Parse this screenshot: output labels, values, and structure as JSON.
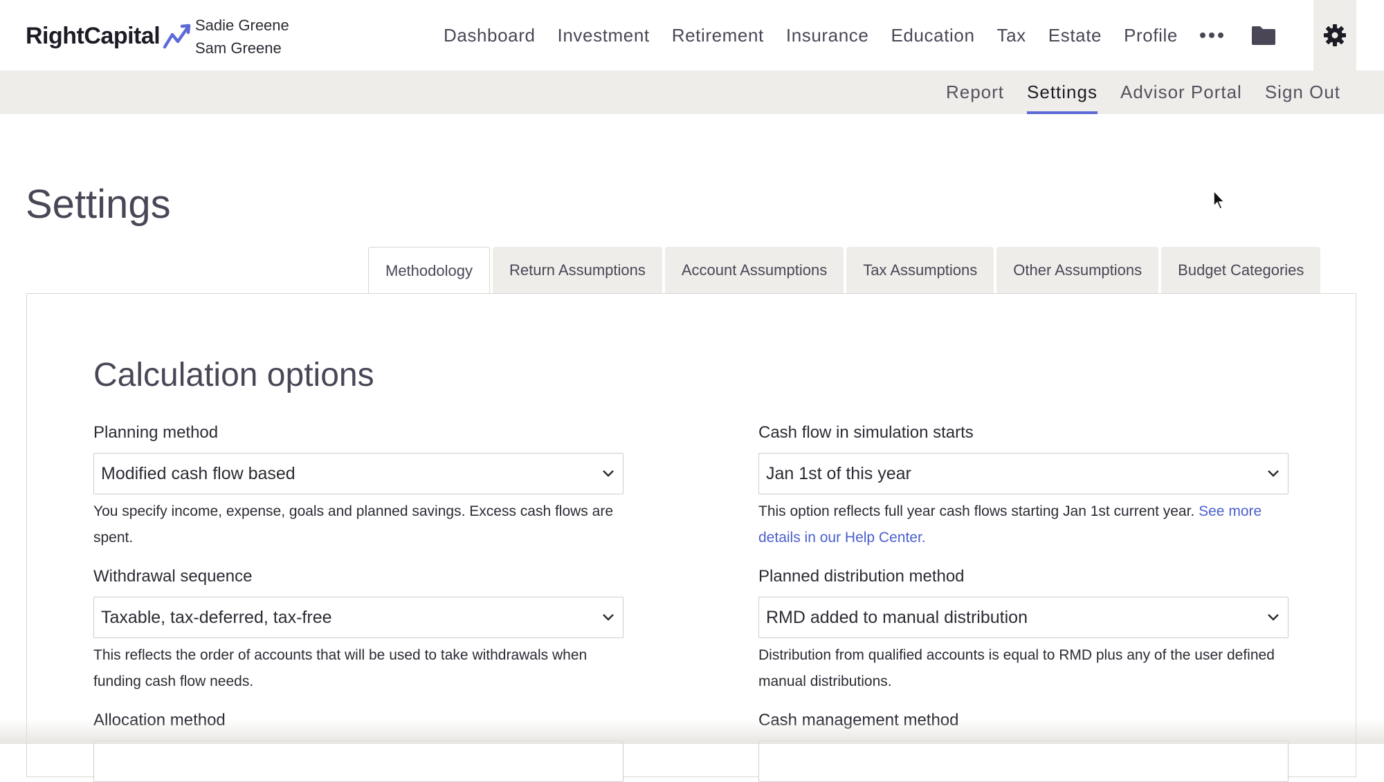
{
  "brand": {
    "name": "RightCapital"
  },
  "clients": [
    "Sadie Greene",
    "Sam Greene"
  ],
  "main_nav": [
    "Dashboard",
    "Investment",
    "Retirement",
    "Insurance",
    "Education",
    "Tax",
    "Estate",
    "Profile"
  ],
  "icons": {
    "more": "more-dots-icon",
    "folder": "folder-icon",
    "settings": "gear-icon"
  },
  "sub_nav": {
    "items": [
      "Report",
      "Settings",
      "Advisor Portal",
      "Sign Out"
    ],
    "active": "Settings"
  },
  "page_title": "Settings",
  "tabs": {
    "items": [
      "Methodology",
      "Return Assumptions",
      "Account Assumptions",
      "Tax Assumptions",
      "Other Assumptions",
      "Budget Categories"
    ],
    "active": "Methodology"
  },
  "section_title": "Calculation options",
  "fields": {
    "planning_method": {
      "label": "Planning method",
      "value": "Modified cash flow based",
      "desc": "You specify income, expense, goals and planned savings. Excess cash flows are spent."
    },
    "cash_flow_start": {
      "label": "Cash flow in simulation starts",
      "value": "Jan 1st of this year",
      "desc": "This option reflects full year cash flows starting Jan 1st current year.",
      "link": "See more details in our Help Center."
    },
    "withdrawal_sequence": {
      "label": "Withdrawal sequence",
      "value": "Taxable, tax-deferred, tax-free",
      "desc": "This reflects the order of accounts that will be used to take withdrawals when funding cash flow needs."
    },
    "distribution_method": {
      "label": "Planned distribution method",
      "value": "RMD added to manual distribution",
      "desc": "Distribution from qualified accounts is equal to RMD plus any of the user defined manual distributions."
    },
    "allocation_method": {
      "label": "Allocation method"
    },
    "cash_management": {
      "label": "Cash management method"
    }
  },
  "colors": {
    "accent": "#5b6ad6",
    "link": "#4a5fcc",
    "subbar_bg": "#efede9"
  }
}
